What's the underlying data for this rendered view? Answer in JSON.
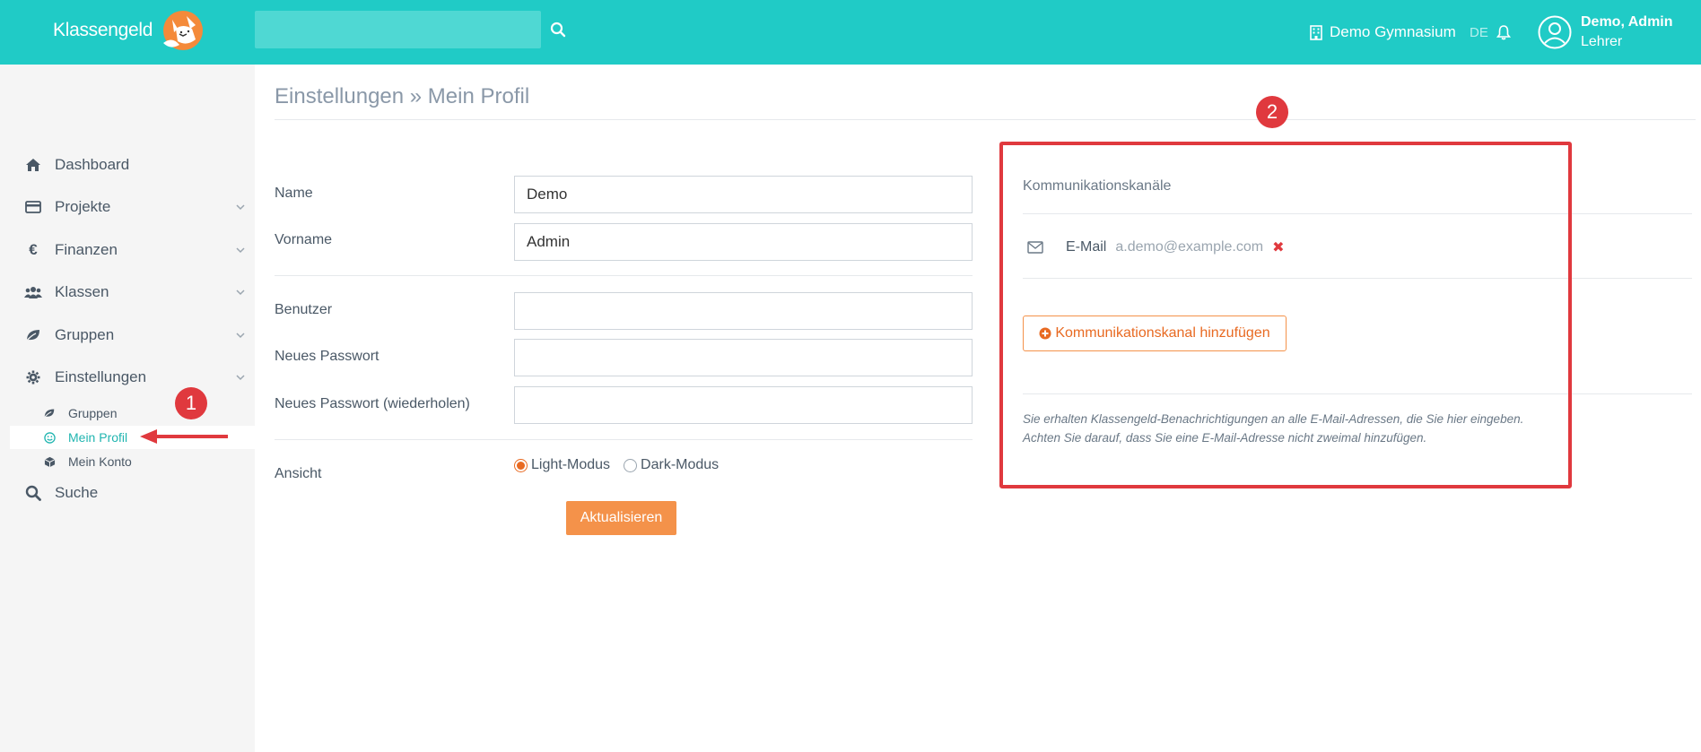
{
  "header": {
    "logo_text": "Klassengeld",
    "search_placeholder": "",
    "school": "Demo Gymnasium",
    "language": "DE",
    "user_name": "Demo, Admin",
    "user_role": "Lehrer",
    "accent_color": "#20cbc6"
  },
  "sidebar": {
    "items": [
      {
        "label": "Dashboard",
        "icon": "home-icon"
      },
      {
        "label": "Projekte",
        "icon": "credit-card-icon"
      },
      {
        "label": "Finanzen",
        "icon": "euro-icon"
      },
      {
        "label": "Klassen",
        "icon": "users-icon"
      },
      {
        "label": "Gruppen",
        "icon": "leaf-icon"
      },
      {
        "label": "Einstellungen",
        "icon": "gear-icon"
      }
    ],
    "sub_items": [
      {
        "label": "Gruppen",
        "icon": "leaf-icon"
      },
      {
        "label": "Mein Profil",
        "icon": "smile-icon",
        "active": true
      },
      {
        "label": "Mein Konto",
        "icon": "cube-icon"
      }
    ],
    "search_label": "Suche"
  },
  "annotations": {
    "badge_1": "1",
    "badge_2": "2"
  },
  "main": {
    "title": "Einstellungen » Mein Profil",
    "form": {
      "name_label": "Name",
      "name_value": "Demo",
      "firstname_label": "Vorname",
      "firstname_value": "Admin",
      "user_label": "Benutzer",
      "user_value": "",
      "password_label": "Neues Passwort",
      "password_repeat_label": "Neues Passwort (wiederholen)",
      "view_label": "Ansicht",
      "light_mode_label": "Light-Modus",
      "dark_mode_label": "Dark-Modus",
      "selected_mode": "Light-Modus",
      "submit_label": "Aktualisieren"
    }
  },
  "channels": {
    "heading": "Kommunikationskanäle",
    "items": [
      {
        "type": "E-Mail",
        "value": "a.demo@example.com",
        "remove": "✖"
      }
    ],
    "add_label": "Kommunikationskanal hinzufügen",
    "note_line1": "Sie erhalten Klassengeld-Benachrichtigungen an alle E-Mail-Adressen, die Sie hier eingeben.",
    "note_line2": "Achten Sie darauf, dass Sie eine E-Mail-Adresse nicht zweimal hinzufügen."
  }
}
